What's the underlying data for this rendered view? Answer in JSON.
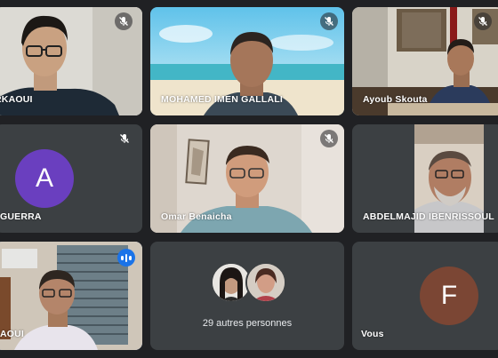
{
  "participants": [
    {
      "name": "RKAOUI",
      "mic": "muted"
    },
    {
      "name": "MOHAMED IMEN GALLALI",
      "mic": "muted"
    },
    {
      "name": "Ayoub Skouta",
      "mic": "muted"
    },
    {
      "name": "GUERRA",
      "mic": "muted",
      "avatar_letter": "A",
      "avatar_color": "#6a3fbf"
    },
    {
      "name": "Omar Benaicha",
      "mic": "muted"
    },
    {
      "name": "ABDELMAJID IBENRISSOUL",
      "mic": "on"
    },
    {
      "name": "AOUI",
      "mic": "speaking"
    },
    {
      "name": "Vous",
      "mic": "on",
      "avatar_letter": "F",
      "avatar_color": "#7b4634"
    }
  ],
  "others": {
    "label": "29 autres personnes"
  },
  "colors": {
    "background": "#202124",
    "tile": "#3c4043",
    "speaking_accent": "#8ab4f8",
    "speaking_badge": "#1a73e8"
  }
}
